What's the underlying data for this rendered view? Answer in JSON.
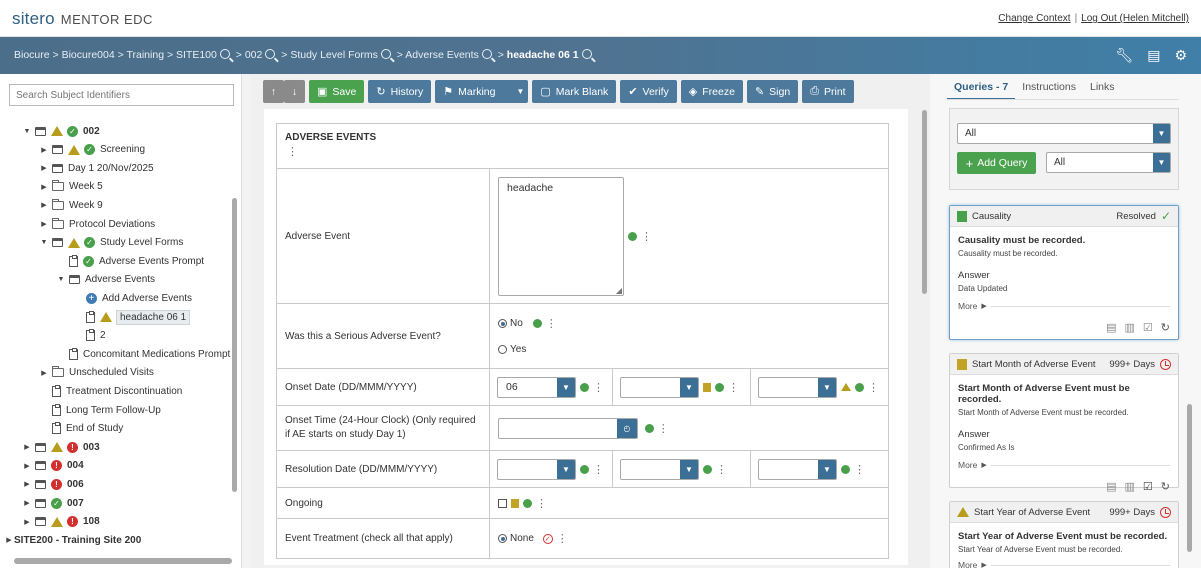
{
  "header": {
    "brand": "sitero",
    "product": "MENTOR EDC",
    "change_context": "Change Context",
    "logout": "Log Out (Helen Mitchell)"
  },
  "breadcrumb": {
    "items": [
      "Biocure",
      "Biocure004",
      "Training",
      "SITE100",
      "002",
      "Study Level Forms",
      "Adverse Events"
    ],
    "current": "headache 06 1"
  },
  "left": {
    "search_placeholder": "Search Subject Identifiers",
    "tree": [
      {
        "label": "002",
        "bold": true,
        "toggle": "down",
        "indent": 0,
        "icon": "cal",
        "status": [
          "warn",
          "ok"
        ]
      },
      {
        "label": "Screening",
        "toggle": "right",
        "indent": 1,
        "icon": "cal",
        "status": [
          "warn",
          "ok"
        ]
      },
      {
        "label": "Day 1 20/Nov/2025",
        "toggle": "right",
        "indent": 1,
        "icon": "cal",
        "status": []
      },
      {
        "label": "Week 5",
        "toggle": "right",
        "indent": 1,
        "icon": "fold",
        "status": []
      },
      {
        "label": "Week 9",
        "toggle": "right",
        "indent": 1,
        "icon": "fold",
        "status": []
      },
      {
        "label": "Protocol Deviations",
        "toggle": "right",
        "indent": 1,
        "icon": "fold",
        "status": []
      },
      {
        "label": "Study Level Forms",
        "toggle": "down",
        "indent": 1,
        "icon": "cal",
        "status": [
          "warn",
          "ok"
        ]
      },
      {
        "label": "Adverse Events Prompt",
        "toggle": "",
        "indent": 2,
        "icon": "doc",
        "status": [
          "ok"
        ]
      },
      {
        "label": "Adverse Events",
        "toggle": "down",
        "indent": 2,
        "icon": "cal",
        "status": []
      },
      {
        "label": "Add Adverse Events",
        "toggle": "",
        "indent": 3,
        "icon": "",
        "status": [
          "plus"
        ]
      },
      {
        "label": "headache 06 1",
        "toggle": "",
        "indent": 3,
        "icon": "doc",
        "status": [
          "warn"
        ],
        "selected": true
      },
      {
        "label": "2",
        "toggle": "",
        "indent": 3,
        "icon": "doc",
        "status": []
      },
      {
        "label": "Concomitant Medications Prompt",
        "toggle": "",
        "indent": 2,
        "icon": "doc",
        "status": []
      },
      {
        "label": "Unscheduled Visits",
        "toggle": "right",
        "indent": 1,
        "icon": "fold",
        "status": []
      },
      {
        "label": "Treatment Discontinuation",
        "toggle": "",
        "indent": 1,
        "icon": "doc",
        "status": []
      },
      {
        "label": "Long Term Follow-Up",
        "toggle": "",
        "indent": 1,
        "icon": "doc",
        "status": []
      },
      {
        "label": "End of Study",
        "toggle": "",
        "indent": 1,
        "icon": "doc",
        "status": []
      },
      {
        "label": "003",
        "bold": true,
        "toggle": "right",
        "indent": 0,
        "icon": "cal",
        "status": [
          "warn",
          "err"
        ]
      },
      {
        "label": "004",
        "bold": true,
        "toggle": "right",
        "indent": 0,
        "icon": "cal",
        "status": [
          "err"
        ]
      },
      {
        "label": "006",
        "bold": true,
        "toggle": "right",
        "indent": 0,
        "icon": "cal",
        "status": [
          "err"
        ]
      },
      {
        "label": "007",
        "bold": true,
        "toggle": "right",
        "indent": 0,
        "icon": "cal",
        "status": [
          "ok"
        ]
      },
      {
        "label": "108",
        "bold": true,
        "toggle": "right",
        "indent": 0,
        "icon": "cal",
        "status": [
          "warn",
          "err"
        ]
      },
      {
        "label": "SITE200 - Training Site 200",
        "bold": true,
        "toggle": "right",
        "indent": -1,
        "icon": "",
        "status": []
      }
    ]
  },
  "toolbar": {
    "save": "Save",
    "history": "History",
    "marking": "Marking",
    "mark_blank": "Mark Blank",
    "verify": "Verify",
    "freeze": "Freeze",
    "sign": "Sign",
    "print": "Print"
  },
  "form": {
    "section_title": "ADVERSE EVENTS",
    "adverse_event_label": "Adverse Event",
    "adverse_event_value": "headache",
    "serious_label": "Was this a Serious Adverse Event?",
    "serious_no": "No",
    "serious_yes": "Yes",
    "onset_date_label": "Onset Date (DD/MMM/YYYY)",
    "onset_day_value": "06",
    "onset_time_label": "Onset Time (24-Hour Clock) (Only required if AE starts on study Day 1)",
    "resolution_label": "Resolution Date (DD/MMM/YYYY)",
    "ongoing_label": "Ongoing",
    "treatment_label": "Event Treatment (check all that apply)",
    "treatment_none": "None"
  },
  "right": {
    "tabs": [
      "Queries - 7",
      "Instructions",
      "Links"
    ],
    "filter_top": "All",
    "add_query": "Add Query",
    "filter_bottom": "All",
    "queries": [
      {
        "title": "Causality",
        "status": "Resolved",
        "message": "Causality must be recorded.",
        "sub": "Causality must be recorded.",
        "answer_label": "Answer",
        "answer": "Data Updated",
        "more": "More"
      },
      {
        "title": "Start Month of Adverse Event",
        "status": "999+ Days",
        "message": "Start Month of Adverse Event must be recorded.",
        "sub": "Start Month of Adverse Event must be recorded.",
        "answer_label": "Answer",
        "answer": "Confirmed As Is",
        "more": "More"
      },
      {
        "title": "Start Year of Adverse Event",
        "status": "999+ Days",
        "message": "Start Year of Adverse Event must be recorded.",
        "sub": "Start Year of Adverse Event must be recorded.",
        "more": "More"
      }
    ]
  }
}
